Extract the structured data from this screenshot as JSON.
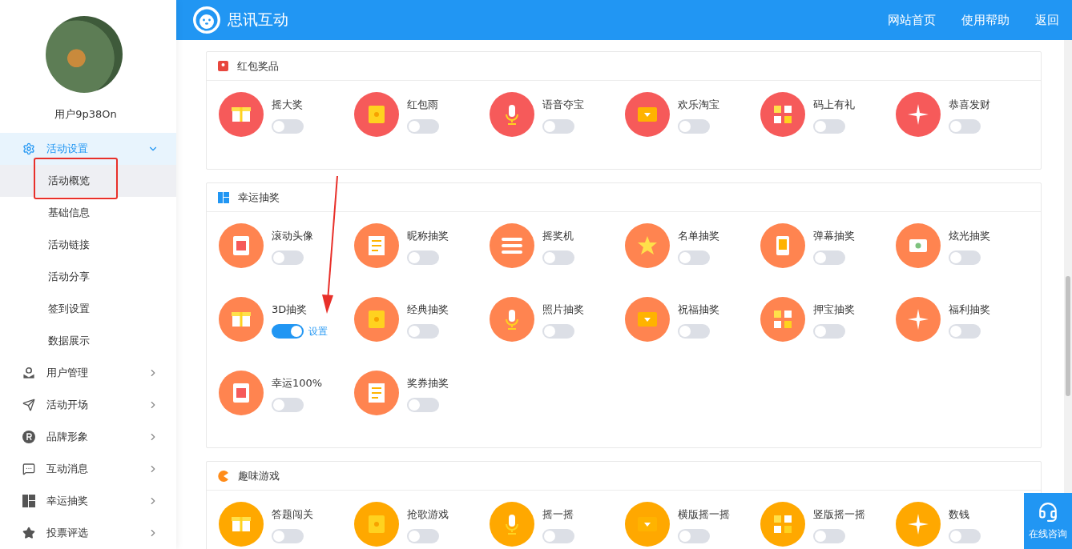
{
  "header": {
    "brand": "思讯互动",
    "nav": [
      "网站首页",
      "使用帮助",
      "返回"
    ]
  },
  "sidebar": {
    "username": "用户9p38On",
    "menu": [
      {
        "label": "活动设置",
        "expanded": true,
        "children": [
          {
            "label": "活动概览",
            "selected": true
          },
          {
            "label": "基础信息",
            "selected": false
          },
          {
            "label": "活动链接",
            "selected": false
          },
          {
            "label": "活动分享",
            "selected": false
          },
          {
            "label": "签到设置",
            "selected": false
          },
          {
            "label": "数据展示",
            "selected": false
          }
        ]
      },
      {
        "label": "用户管理",
        "expanded": false
      },
      {
        "label": "活动开场",
        "expanded": false
      },
      {
        "label": "品牌形象",
        "expanded": false
      },
      {
        "label": "互动消息",
        "expanded": false
      },
      {
        "label": "幸运抽奖",
        "expanded": false
      },
      {
        "label": "投票评选",
        "expanded": false
      }
    ]
  },
  "sections": [
    {
      "title": "红包奖品",
      "color": "#f65a5a",
      "items": [
        {
          "name": "摇大奖",
          "on": false
        },
        {
          "name": "红包雨",
          "on": false
        },
        {
          "name": "语音夺宝",
          "on": false
        },
        {
          "name": "欢乐淘宝",
          "on": false
        },
        {
          "name": "码上有礼",
          "on": false
        },
        {
          "name": "恭喜发财",
          "on": false
        }
      ]
    },
    {
      "title": "幸运抽奖",
      "color": "#ff8450",
      "items": [
        {
          "name": "滚动头像",
          "on": false
        },
        {
          "name": "昵称抽奖",
          "on": false
        },
        {
          "name": "摇奖机",
          "on": false
        },
        {
          "name": "名单抽奖",
          "on": false
        },
        {
          "name": "弹幕抽奖",
          "on": false
        },
        {
          "name": "炫光抽奖",
          "on": false
        },
        {
          "name": "3D抽奖",
          "on": true,
          "action": "设置"
        },
        {
          "name": "经典抽奖",
          "on": false
        },
        {
          "name": "照片抽奖",
          "on": false
        },
        {
          "name": "祝福抽奖",
          "on": false
        },
        {
          "name": "押宝抽奖",
          "on": false
        },
        {
          "name": "福利抽奖",
          "on": false
        },
        {
          "name": "幸运100%",
          "on": false
        },
        {
          "name": "奖券抽奖",
          "on": false
        }
      ]
    },
    {
      "title": "趣味游戏",
      "color": "#ffa800",
      "items": [
        {
          "name": "答题闯关",
          "on": false
        },
        {
          "name": "抢歌游戏",
          "on": false
        },
        {
          "name": "摇一摇",
          "on": false
        },
        {
          "name": "横版摇一摇",
          "on": false
        },
        {
          "name": "竖版摇一摇",
          "on": false
        },
        {
          "name": "数钱",
          "on": false
        }
      ]
    }
  ],
  "float_button": {
    "label": "在线咨询"
  }
}
